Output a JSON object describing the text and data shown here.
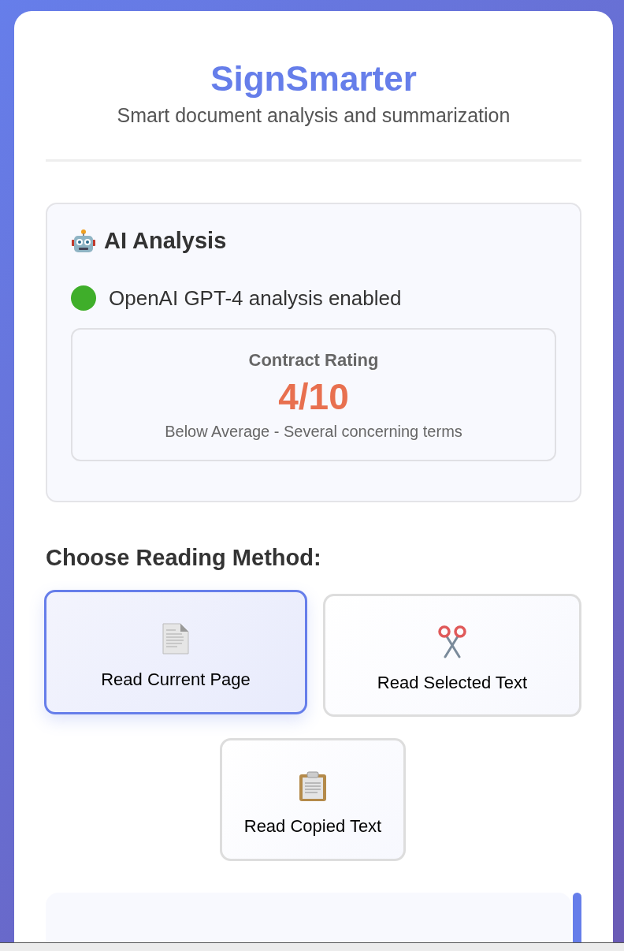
{
  "header": {
    "title": "SignSmarter",
    "subtitle": "Smart document analysis and summarization"
  },
  "ai_analysis": {
    "heading": "AI Analysis",
    "status": {
      "text": "OpenAI GPT-4 analysis enabled",
      "color": "#3fae2a"
    },
    "rating": {
      "label": "Contract Rating",
      "value": "4/10",
      "description": "Below Average - Several concerning terms"
    }
  },
  "reading_method": {
    "heading": "Choose Reading Method:",
    "options": [
      {
        "label": "Read Current Page",
        "kind": "page",
        "selected": true
      },
      {
        "label": "Read Selected Text",
        "kind": "scissors",
        "selected": false
      },
      {
        "label": "Read Copied Text",
        "kind": "clipboard",
        "selected": false
      }
    ]
  }
}
